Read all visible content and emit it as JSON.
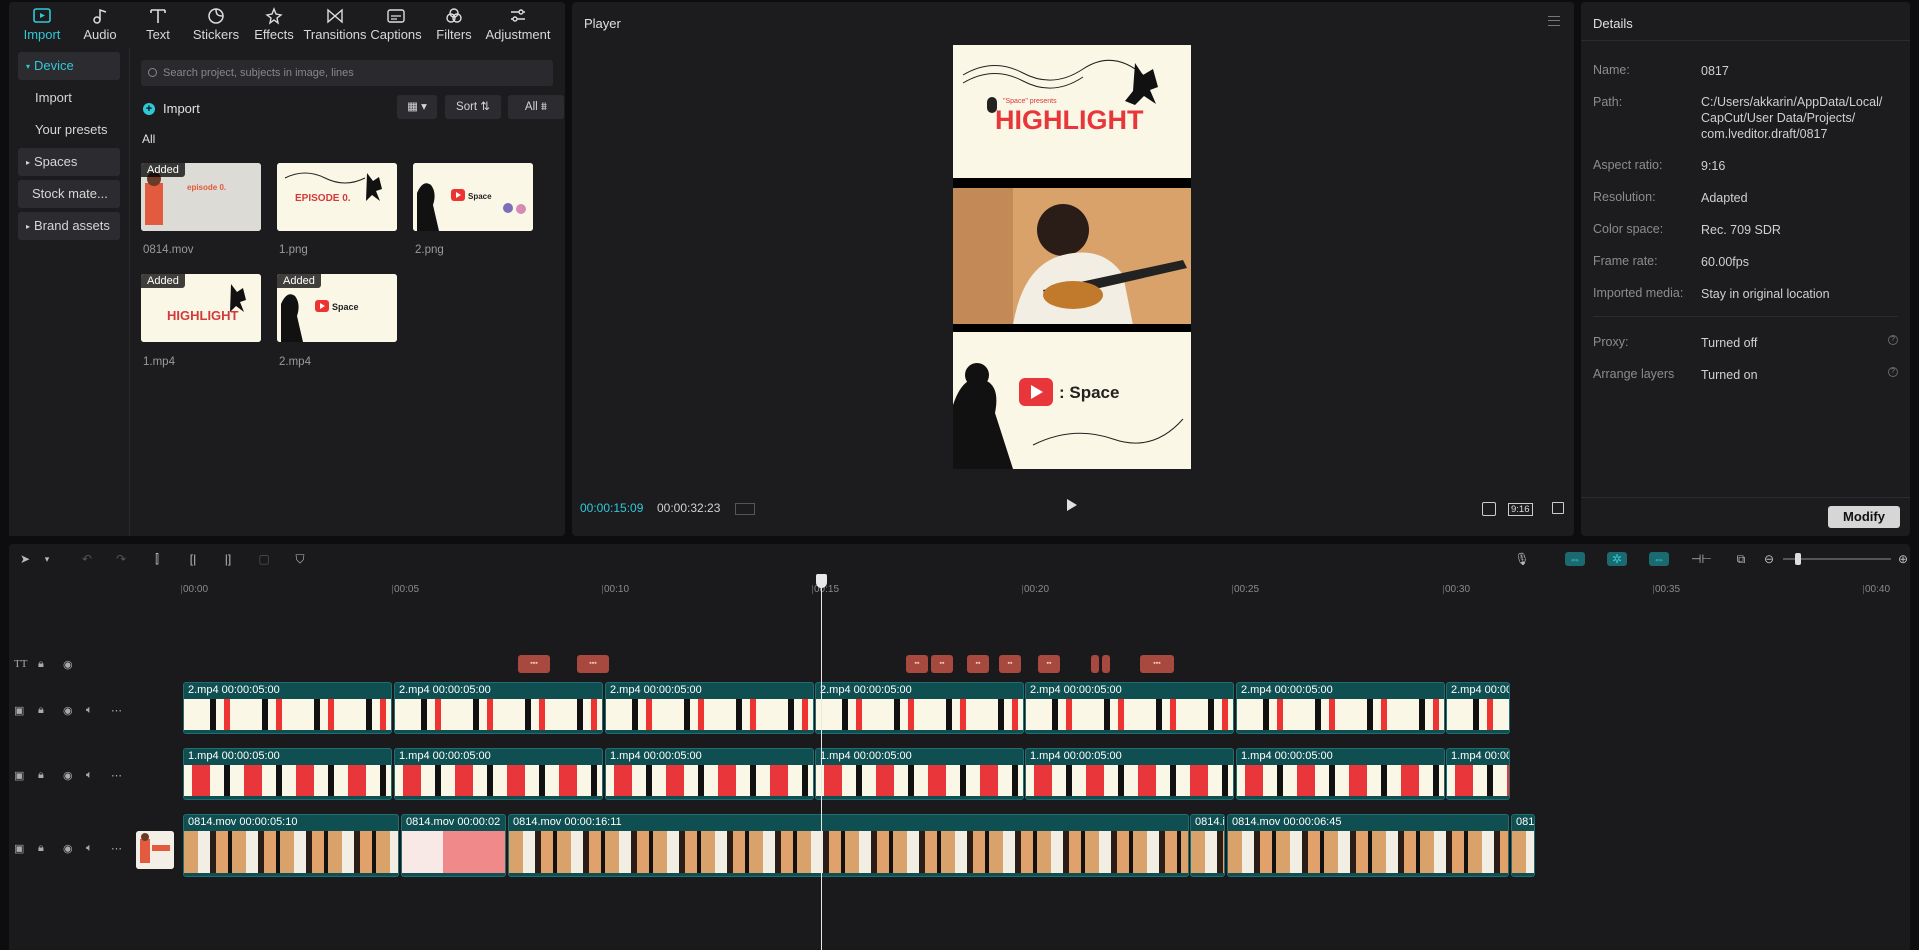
{
  "toolbar_tabs": [
    {
      "label": "Import",
      "icon": "import-icon",
      "active": true
    },
    {
      "label": "Audio",
      "icon": "audio-icon"
    },
    {
      "label": "Text",
      "icon": "text-icon"
    },
    {
      "label": "Stickers",
      "icon": "stickers-icon"
    },
    {
      "label": "Effects",
      "icon": "effects-icon"
    },
    {
      "label": "Transitions",
      "icon": "transitions-icon"
    },
    {
      "label": "Captions",
      "icon": "captions-icon"
    },
    {
      "label": "Filters",
      "icon": "filters-icon"
    },
    {
      "label": "Adjustment",
      "icon": "adjustment-icon"
    }
  ],
  "sidebar": {
    "device": "Device",
    "import": "Import",
    "presets": "Your presets",
    "spaces": "Spaces",
    "stock": "Stock mate...",
    "brand": "Brand assets"
  },
  "media": {
    "search_placeholder": "Search project, subjects in image, lines",
    "import_label": "Import",
    "sort_label": "Sort",
    "filter_label": "All",
    "section_label": "All",
    "added_badge": "Added",
    "items": [
      {
        "name": "0814.mov",
        "added": true
      },
      {
        "name": "1.png",
        "added": false
      },
      {
        "name": "2.png",
        "added": false
      },
      {
        "name": "1.mp4",
        "added": true
      },
      {
        "name": "2.mp4",
        "added": true
      }
    ],
    "thumb_text": {
      "ep": "EPISODE 0.",
      "space": "Space",
      "highlight": "HIGHLIGHT",
      "presents": "\"Space\" presents"
    }
  },
  "player": {
    "title": "Player",
    "current_time": "00:00:15:09",
    "total_time": "00:00:32:23",
    "ratio": "9:16",
    "video_text": {
      "highlight": "HIGHLIGHT",
      "space": ": Space",
      "presents": "\"Space\" presents"
    }
  },
  "details": {
    "title": "Details",
    "rows": [
      {
        "label": "Name:",
        "value": "0817"
      },
      {
        "label": "Path:",
        "value": "C:/Users/akkarin/AppData/Local/ CapCut/User Data/Projects/ com.lveditor.draft/0817"
      },
      {
        "label": "Aspect ratio:",
        "value": "9:16"
      },
      {
        "label": "Resolution:",
        "value": "Adapted"
      },
      {
        "label": "Color space:",
        "value": "Rec. 709 SDR"
      },
      {
        "label": "Frame rate:",
        "value": "60.00fps"
      },
      {
        "label": "Imported media:",
        "value": "Stay in original location"
      },
      {
        "label": "Proxy:",
        "value": "Turned off"
      },
      {
        "label": "Arrange layers",
        "value": "Turned on"
      }
    ],
    "modify_label": "Modify"
  },
  "timeline": {
    "ticks": [
      "00:00",
      "00:05",
      "00:10",
      "00:15",
      "00:20",
      "00:25",
      "00:30",
      "00:35",
      "00:40"
    ],
    "track_2mp4": [
      {
        "name": "2.mp4",
        "dur": "00:00:05:00"
      },
      {
        "name": "2.mp4",
        "dur": "00:00:05:00"
      },
      {
        "name": "2.mp4",
        "dur": "00:00:05:00"
      },
      {
        "name": "2.mp4",
        "dur": "00:00:05:00"
      },
      {
        "name": "2.mp4",
        "dur": "00:00:05:00"
      },
      {
        "name": "2.mp4",
        "dur": "00:00:05:00"
      },
      {
        "name": "2.mp4",
        "dur": "00:00:0"
      }
    ],
    "track_1mp4": [
      {
        "name": "1.mp4",
        "dur": "00:00:05:00"
      },
      {
        "name": "1.mp4",
        "dur": "00:00:05:00"
      },
      {
        "name": "1.mp4",
        "dur": "00:00:05:00"
      },
      {
        "name": "1.mp4",
        "dur": "00:00:05:00"
      },
      {
        "name": "1.mp4",
        "dur": "00:00:05:00"
      },
      {
        "name": "1.mp4",
        "dur": "00:00:05:00"
      },
      {
        "name": "1.mp4",
        "dur": "00:00:0"
      }
    ],
    "track_main": [
      {
        "name": "0814.mov",
        "dur": "00:00:05:10"
      },
      {
        "name": "0814.mov",
        "dur": "00:00:02"
      },
      {
        "name": "0814.mov",
        "dur": "00:00:16:11"
      },
      {
        "name": "0814.i",
        "dur": ""
      },
      {
        "name": "0814.mov",
        "dur": "00:00:06:45"
      },
      {
        "name": "0814.",
        "dur": ""
      }
    ]
  }
}
